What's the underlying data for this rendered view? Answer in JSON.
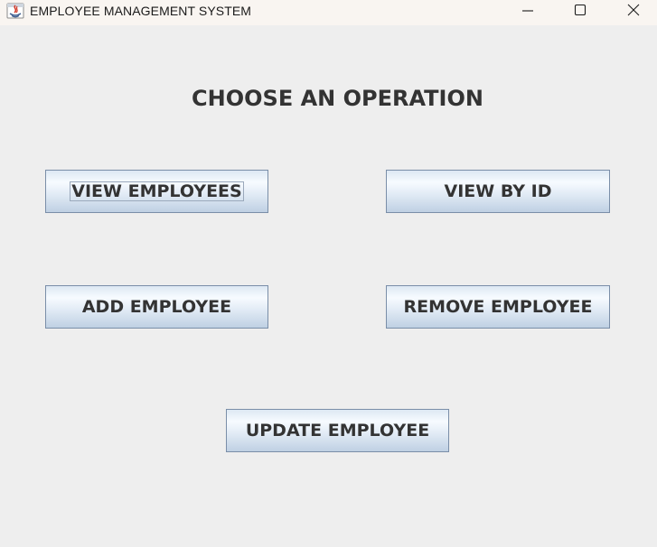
{
  "window": {
    "title": "EMPLOYEE MANAGEMENT SYSTEM",
    "controls": {
      "minimize": "minimize",
      "maximize": "maximize",
      "close": "close"
    }
  },
  "main": {
    "heading": "CHOOSE AN OPERATION",
    "buttons": {
      "view_employees": "VIEW EMPLOYEES",
      "view_by_id": "VIEW BY ID",
      "add_employee": "ADD EMPLOYEE",
      "remove_employee": "REMOVE EMPLOYEE",
      "update_employee": "UPDATE EMPLOYEE"
    }
  },
  "colors": {
    "background": "#eeeeee",
    "titlebar": "#f9f5f1",
    "button_border": "#7a8ea8",
    "text": "#333333"
  },
  "icons": [
    "java-app-icon",
    "minimize-icon",
    "maximize-icon",
    "close-icon"
  ]
}
